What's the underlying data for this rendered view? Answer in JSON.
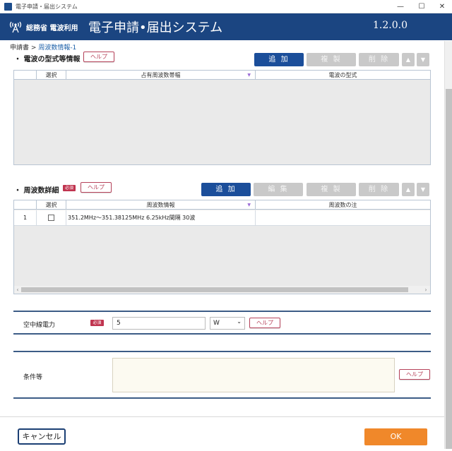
{
  "window": {
    "title": "電子申請・届出システム",
    "controls": [
      "—",
      "☐",
      "✕"
    ]
  },
  "header": {
    "ministry": "総務省 電波利用",
    "app_title": "電子申請•届出システム",
    "version": "1.2.0.0"
  },
  "breadcrumb": {
    "root": "申請書",
    "separator": ">",
    "current": "周波数情報-1"
  },
  "section1": {
    "bullet": "・",
    "title": "電波の型式等情報",
    "help_label": "ヘルプ",
    "buttons": {
      "add": "追 加",
      "copy": "複 製",
      "delete": "削 除",
      "up": "▲",
      "down": "▼"
    },
    "columns": [
      "",
      "選択",
      "占有周波数帯幅",
      "電波の型式"
    ],
    "sort_icon": "▼"
  },
  "section2": {
    "bullet": "・",
    "title": "周波数詳細",
    "required": "必須",
    "help_label": "ヘルプ",
    "buttons": {
      "add": "追 加",
      "edit": "編 集",
      "copy": "複 製",
      "delete": "削 除",
      "up": "▲",
      "down": "▼"
    },
    "columns": [
      "",
      "選択",
      "周波数情報",
      "周波数の注"
    ],
    "sort_icon": "▼",
    "rows": [
      {
        "num": "1",
        "checked": false,
        "info": "351.2MHz～351.38125MHz 6.25kHz間隔 30波",
        "note": ""
      }
    ],
    "scroll_left": "‹",
    "scroll_right": "›"
  },
  "power": {
    "label": "空中線電力",
    "required": "必須",
    "value": "5",
    "unit": "W",
    "unit_arrow": "⌄",
    "help_label": "ヘルプ"
  },
  "conditions": {
    "label": "条件等",
    "value": "",
    "help_label": "ヘルプ"
  },
  "footer": {
    "cancel": "キャンセル",
    "ok": "OK"
  },
  "colors": {
    "header": "#1b4581",
    "primary": "#1b4e9a",
    "help": "#b6425a",
    "required": "#c0344f",
    "ok": "#f0882a"
  }
}
